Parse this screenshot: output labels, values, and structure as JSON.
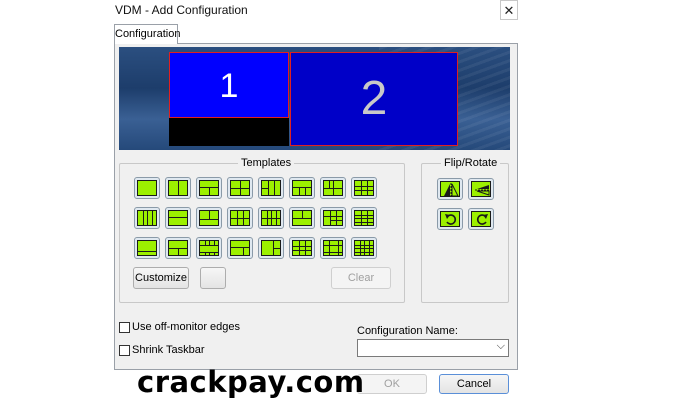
{
  "window": {
    "title": "VDM - Add Configuration",
    "close_glyph": "✕"
  },
  "tabs": [
    {
      "label": "Configuration"
    }
  ],
  "preview": {
    "monitor1": "1",
    "monitor2": "2"
  },
  "templates": {
    "label": "Templates",
    "layouts": [
      "full",
      "half-v",
      "t-split",
      "quad",
      "cols-4-ish",
      "top-1-bottom-3",
      "quad-plus",
      "grid-3x3",
      "cols-4",
      "top-wide-bottom-2",
      "bottom-wide-top-2",
      "grid-3x2",
      "cols-3-rows",
      "top-split-bottom",
      "grid-mixed",
      "grid-3x3b",
      "bottom-band",
      "center-box",
      "strip-top",
      "big-bottom",
      "big-left",
      "quad-center",
      "frame",
      "grid-4x4"
    ],
    "customize_label": "Customize",
    "clear_label": "Clear"
  },
  "flip_rotate": {
    "label": "Flip/Rotate",
    "icons": [
      "flip-horizontal-icon",
      "flip-vertical-icon",
      "rotate-clockwise-icon",
      "rotate-counterclockwise-icon"
    ]
  },
  "options": {
    "off_monitor_edges": "Use off-monitor edges",
    "shrink_taskbar": "Shrink Taskbar"
  },
  "config_name": {
    "label": "Configuration Name:",
    "value": ""
  },
  "buttons": {
    "ok": "OK",
    "cancel": "Cancel"
  },
  "watermark": "crackpay.com"
}
